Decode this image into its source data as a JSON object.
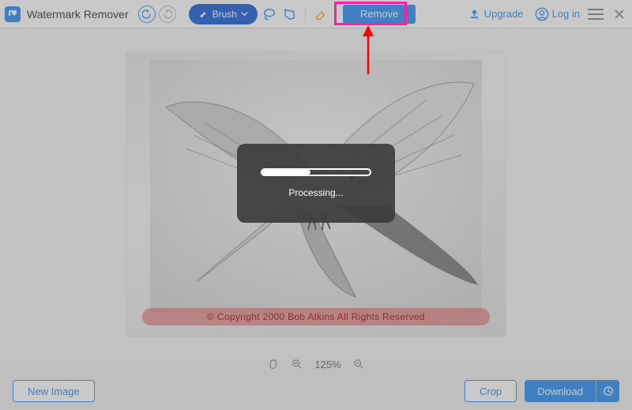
{
  "app": {
    "title": "Watermark Remover"
  },
  "toolbar": {
    "brush_label": "Brush",
    "remove_label": "Remove",
    "upgrade_label": "Upgrade",
    "login_label": "Log in"
  },
  "canvas": {
    "watermark_text": "© Copyright  2000   Bob Atkins   All Rights Reserved"
  },
  "zoom": {
    "level_label": "125%"
  },
  "processing": {
    "label": "Processing..."
  },
  "footer": {
    "new_image_label": "New Image",
    "crop_label": "Crop",
    "download_label": "Download"
  }
}
